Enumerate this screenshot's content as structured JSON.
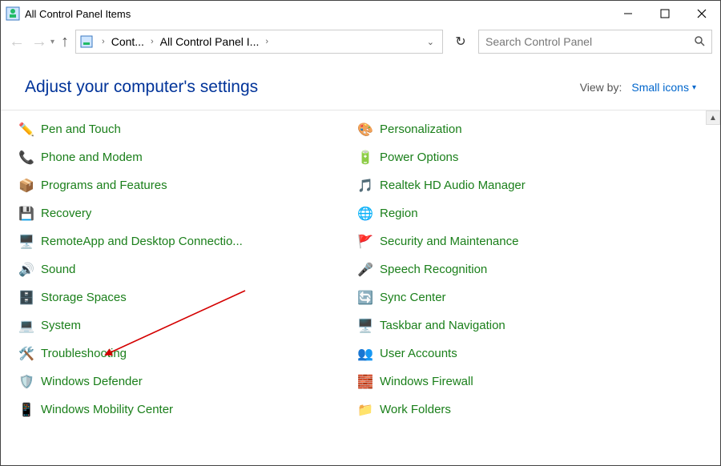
{
  "window": {
    "title": "All Control Panel Items"
  },
  "breadcrumb": {
    "crumb1": "Cont...",
    "crumb2": "All Control Panel I..."
  },
  "search": {
    "placeholder": "Search Control Panel"
  },
  "heading": "Adjust your computer's settings",
  "viewby": {
    "label": "View by:",
    "value": "Small icons"
  },
  "items_left": [
    {
      "icon": "✏️",
      "label": "Pen and Touch"
    },
    {
      "icon": "📞",
      "label": "Phone and Modem"
    },
    {
      "icon": "📦",
      "label": "Programs and Features"
    },
    {
      "icon": "💾",
      "label": "Recovery"
    },
    {
      "icon": "🖥️",
      "label": "RemoteApp and Desktop Connectio..."
    },
    {
      "icon": "🔊",
      "label": "Sound"
    },
    {
      "icon": "🗄️",
      "label": "Storage Spaces"
    },
    {
      "icon": "💻",
      "label": "System"
    },
    {
      "icon": "🛠️",
      "label": "Troubleshooting"
    },
    {
      "icon": "🛡️",
      "label": "Windows Defender"
    },
    {
      "icon": "📱",
      "label": "Windows Mobility Center"
    }
  ],
  "items_right": [
    {
      "icon": "🎨",
      "label": "Personalization"
    },
    {
      "icon": "🔋",
      "label": "Power Options"
    },
    {
      "icon": "🎵",
      "label": "Realtek HD Audio Manager"
    },
    {
      "icon": "🌐",
      "label": "Region"
    },
    {
      "icon": "🚩",
      "label": "Security and Maintenance"
    },
    {
      "icon": "🎤",
      "label": "Speech Recognition"
    },
    {
      "icon": "🔄",
      "label": "Sync Center"
    },
    {
      "icon": "🖥️",
      "label": "Taskbar and Navigation"
    },
    {
      "icon": "👥",
      "label": "User Accounts"
    },
    {
      "icon": "🧱",
      "label": "Windows Firewall"
    },
    {
      "icon": "📁",
      "label": "Work Folders"
    }
  ]
}
